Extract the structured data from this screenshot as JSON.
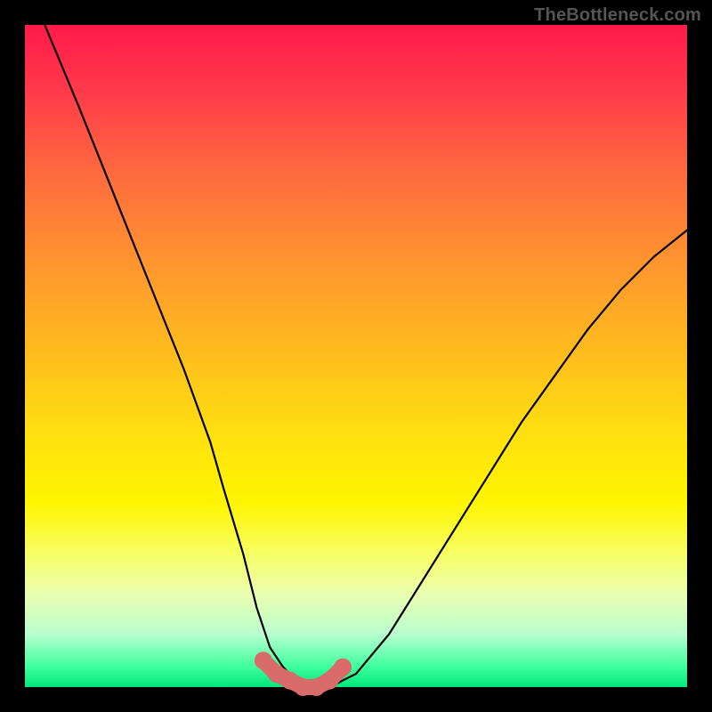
{
  "watermark": "TheBottleneck.com",
  "chart_data": {
    "type": "line",
    "title": "",
    "xlabel": "",
    "ylabel": "",
    "xlim": [
      0,
      100
    ],
    "ylim": [
      0,
      100
    ],
    "grid": false,
    "series": [
      {
        "name": "bottleneck-curve",
        "x": [
          3,
          8,
          12,
          16,
          20,
          24,
          28,
          30,
          33,
          35,
          37,
          39,
          41,
          43,
          46,
          50,
          55,
          60,
          65,
          70,
          75,
          80,
          85,
          90,
          95,
          100
        ],
        "values": [
          100,
          88,
          78,
          68,
          58,
          48,
          37,
          30,
          20,
          12,
          6,
          3,
          1,
          0,
          0,
          2,
          8,
          16,
          24,
          32,
          40,
          47,
          54,
          60,
          65,
          69
        ],
        "color": "#000000"
      },
      {
        "name": "optimal-band",
        "x": [
          36,
          38,
          40,
          42,
          44,
          46,
          48
        ],
        "values": [
          4,
          2,
          1,
          0,
          0,
          1,
          3
        ],
        "color": "#d96b6b"
      }
    ],
    "annotations": []
  }
}
